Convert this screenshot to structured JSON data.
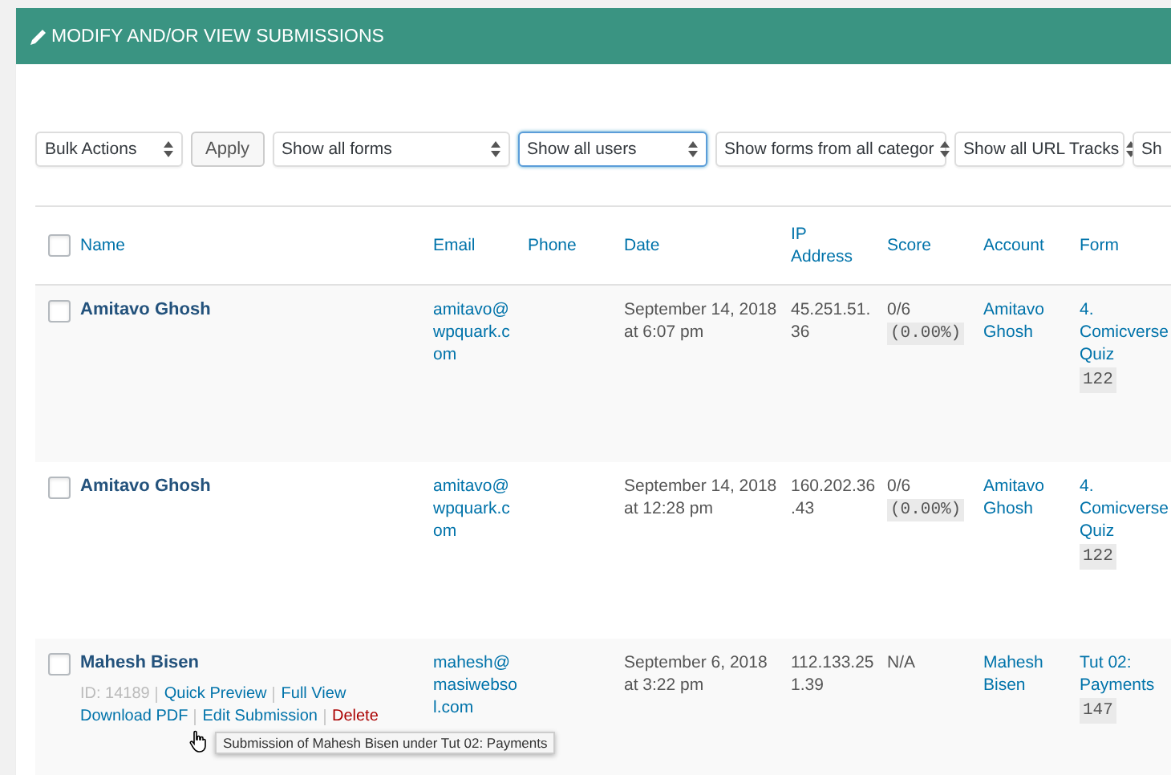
{
  "panel": {
    "title": "MODIFY AND/OR VIEW SUBMISSIONS"
  },
  "filters": [
    {
      "kind": "select",
      "label": "Bulk Actions",
      "focused": false
    },
    {
      "kind": "button",
      "label": "Apply",
      "focused": false
    },
    {
      "kind": "select",
      "label": "Show all forms",
      "focused": false
    },
    {
      "kind": "select",
      "label": "Show all users",
      "focused": true
    },
    {
      "kind": "select",
      "label": "Show forms from all categor",
      "focused": false
    },
    {
      "kind": "select",
      "label": "Show all URL Tracks",
      "focused": false
    },
    {
      "kind": "select",
      "label": "Sh",
      "focused": false
    }
  ],
  "table": {
    "select_all": {
      "checked": false
    },
    "columns": [
      "Name",
      "Email",
      "Phone",
      "Date",
      "IP Address",
      "Score",
      "Account",
      "Form"
    ],
    "rows": [
      {
        "checked": false,
        "name": "Amitavo Ghosh",
        "email": "amitavo@wpquark.com",
        "phone": "",
        "date": "September 14, 2018 at 6:07 pm",
        "ip": "45.251.51.36",
        "score": "0/6",
        "score_percent": "(0.00%)",
        "account": "Amitavo Ghosh",
        "form": "4. Comicverse Quiz",
        "form_id": "122"
      },
      {
        "checked": false,
        "name": "Amitavo Ghosh",
        "email": "amitavo@wpquark.com",
        "phone": "",
        "date": "September 14, 2018 at 12:28 pm",
        "ip": "160.202.36.43",
        "score": "0/6",
        "score_percent": "(0.00%)",
        "account": "Amitavo Ghosh",
        "form": "4. Comicverse Quiz",
        "form_id": "122"
      },
      {
        "checked": false,
        "name": "Mahesh Bisen",
        "email": "mahesh@masiwebsol.com",
        "phone": "",
        "date": "September 6, 2018 at 3:22 pm",
        "ip": "112.133.251.39",
        "score": "N/A",
        "account": "Mahesh Bisen",
        "form": "Tut 02: Payments",
        "form_id": "147",
        "actions": [
          {
            "kind": "id",
            "label": "ID: 14189"
          },
          {
            "kind": "link",
            "label": "Quick Preview"
          },
          {
            "kind": "link",
            "label": "Full View"
          },
          {
            "kind": "link",
            "label": "Download PDF"
          },
          {
            "kind": "link",
            "label": "Edit Submission"
          },
          {
            "kind": "danger",
            "label": "Delete"
          }
        ],
        "tooltip": "Submission of Mahesh Bisen under Tut 02: Payments"
      }
    ]
  }
}
